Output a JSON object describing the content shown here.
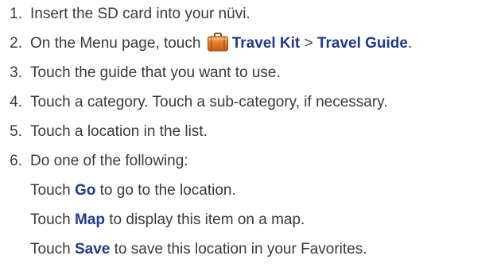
{
  "steps": [
    {
      "num": "1.",
      "text": "Insert the SD card into your nüvi."
    },
    {
      "num": "2.",
      "prefix": "On the Menu page, touch ",
      "link1": "Travel Kit",
      "sep": " > ",
      "link2": "Travel Guide",
      "suffix": ".",
      "icon": "suitcase-icon"
    },
    {
      "num": "3.",
      "text": "Touch the guide that you want to use."
    },
    {
      "num": "4.",
      "text": "Touch a category. Touch a sub-category, if necessary."
    },
    {
      "num": "5.",
      "text": "Touch a location in the list."
    },
    {
      "num": "6.",
      "text": "Do one of the following:"
    }
  ],
  "sub_steps": [
    {
      "pre": "Touch ",
      "kw": "Go",
      "post": " to go to the location."
    },
    {
      "pre": "Touch ",
      "kw": "Map",
      "post": " to display this item on a map."
    },
    {
      "pre": "Touch ",
      "kw": "Save",
      "post": " to save this location in your Favorites."
    }
  ],
  "colors": {
    "body_text": "#3a3a3a",
    "keyword": "#1f3a8f",
    "suitcase_orange": "#e8761c"
  }
}
